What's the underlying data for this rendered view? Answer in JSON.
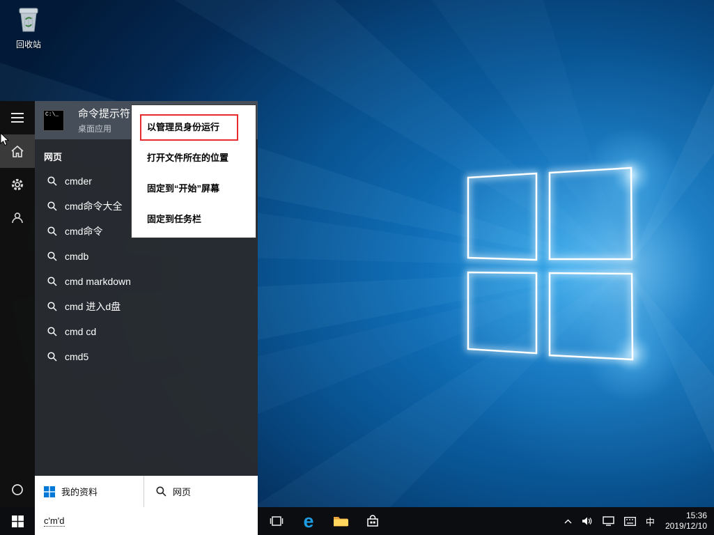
{
  "colors": {
    "annotation_red": "#e52b2b",
    "selection_gray": "#454e59",
    "taskbar_black": "#0c0d10",
    "accent_blue": "#0078d7"
  },
  "desktop": {
    "recycle_bin": {
      "label": "回收站"
    }
  },
  "start": {
    "top_result": {
      "title": "命令提示符",
      "subtitle": "桌面应用"
    },
    "context_menu": {
      "items": [
        "以管理员身份运行",
        "打开文件所在的位置",
        "固定到“开始”屏幕",
        "固定到任务栏"
      ]
    },
    "web_header": "网页",
    "suggestions": [
      "cmder",
      "cmd命令大全",
      "cmd命令",
      "cmdb",
      "cmd markdown",
      "cmd 进入d盘",
      "cmd cd",
      "cmd5"
    ],
    "footer": {
      "my_stuff": "我的资料",
      "web": "网页"
    },
    "search": {
      "value": "c'm'd"
    }
  },
  "taskbar": {
    "tray": {
      "ime": "中",
      "time": "15:36",
      "date": "2019/12/10"
    }
  }
}
